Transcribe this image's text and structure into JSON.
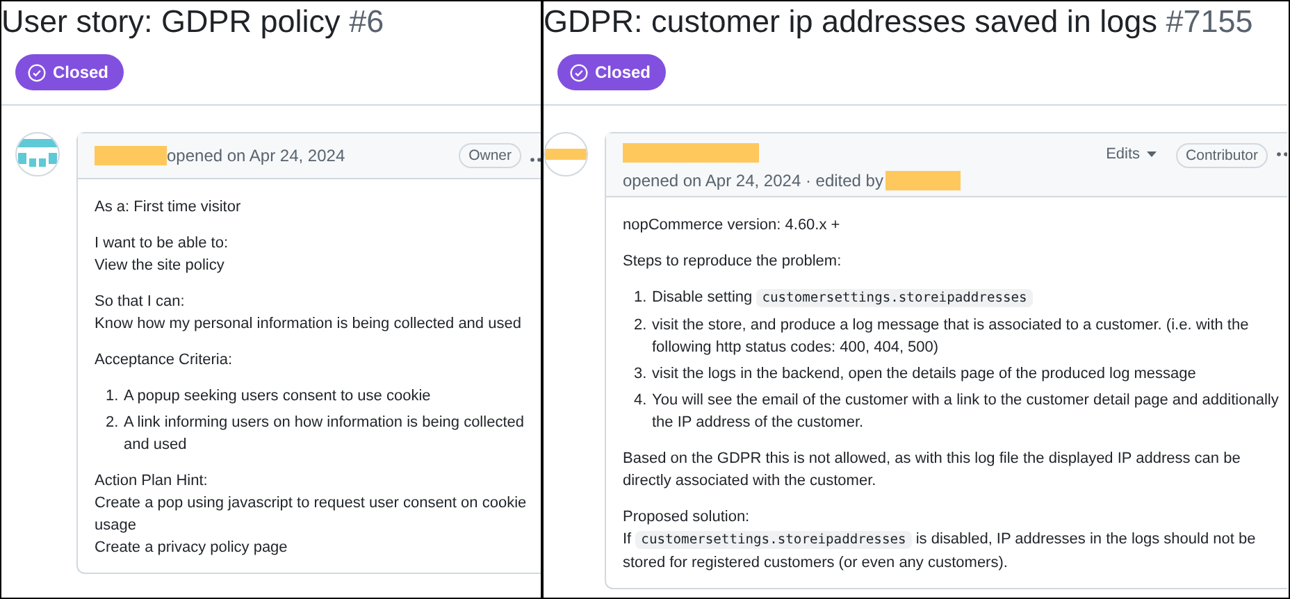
{
  "panels": [
    {
      "title": "User story: GDPR policy",
      "number": "#6",
      "status": {
        "kind": "closed",
        "label": "Closed"
      },
      "avatar": {
        "kind": "identicon"
      },
      "comment": {
        "author_hidden": true,
        "meta": "opened on Apr 24, 2024",
        "editor_hidden": false,
        "role": "Owner",
        "body": [
          {
            "kind": "paragraph",
            "lines": [
              [
                {
                  "kind": "text",
                  "text": "As a: First time visitor"
                }
              ]
            ]
          },
          {
            "kind": "paragraph",
            "lines": [
              [
                {
                  "kind": "text",
                  "text": "I want to be able to:"
                }
              ],
              [
                {
                  "kind": "text",
                  "text": "View the site policy"
                }
              ]
            ]
          },
          {
            "kind": "paragraph",
            "lines": [
              [
                {
                  "kind": "text",
                  "text": "So that I can:"
                }
              ],
              [
                {
                  "kind": "text",
                  "text": "Know how my personal information is being collected and used"
                }
              ]
            ]
          },
          {
            "kind": "paragraph",
            "lines": [
              [
                {
                  "kind": "text",
                  "text": "Acceptance Criteria:"
                }
              ]
            ]
          },
          {
            "kind": "ordered_list",
            "items": [
              {
                "marker": "1.",
                "segments": [
                  {
                    "kind": "text",
                    "text": "A popup seeking users consent to use cookie"
                  }
                ]
              },
              {
                "marker": "2.",
                "segments": [
                  {
                    "kind": "text",
                    "text": "A link informing users on how information is being collected and used"
                  }
                ]
              }
            ]
          },
          {
            "kind": "paragraph",
            "lines": [
              [
                {
                  "kind": "text",
                  "text": "Action Plan Hint:"
                }
              ],
              [
                {
                  "kind": "text",
                  "text": "Create a pop using javascript to request user consent on cookie usage"
                }
              ],
              [
                {
                  "kind": "text",
                  "text": "Create a privacy policy page"
                }
              ]
            ]
          }
        ]
      }
    },
    {
      "title": "GDPR: customer ip addresses saved in logs",
      "number": "#7155",
      "status": {
        "kind": "closed",
        "label": "Closed"
      },
      "avatar": {
        "kind": "hidden"
      },
      "comment": {
        "author_hidden": true,
        "meta": "opened on Apr 24, 2024 · edited by",
        "editor_hidden": true,
        "edits": "Edits",
        "role": "Contributor",
        "body": [
          {
            "kind": "paragraph",
            "lines": [
              [
                {
                  "kind": "text",
                  "text": "nopCommerce version: 4.60.x +"
                }
              ]
            ]
          },
          {
            "kind": "paragraph",
            "lines": [
              [
                {
                  "kind": "text",
                  "text": "Steps to reproduce the problem:"
                }
              ]
            ]
          },
          {
            "kind": "ordered_list",
            "items": [
              {
                "marker": "1.",
                "segments": [
                  {
                    "kind": "text",
                    "text": "Disable setting "
                  },
                  {
                    "kind": "code",
                    "text": "customersettings.storeipaddresses"
                  }
                ]
              },
              {
                "marker": "2.",
                "segments": [
                  {
                    "kind": "text",
                    "text": "visit the store, and produce a log message that is associated to a customer. (i.e. with the following http status codes: 400, 404, 500)"
                  }
                ]
              },
              {
                "marker": "3.",
                "segments": [
                  {
                    "kind": "text",
                    "text": "visit the logs in the backend, open the details page of the produced log message"
                  }
                ]
              },
              {
                "marker": "4.",
                "segments": [
                  {
                    "kind": "text",
                    "text": "You will see the email of the customer with a link to the customer detail page and additionally the IP address of the customer."
                  }
                ]
              }
            ]
          },
          {
            "kind": "paragraph",
            "lines": [
              [
                {
                  "kind": "text",
                  "text": "Based on the GDPR this is not allowed, as with this log file the displayed IP address can be directly associated with the customer."
                }
              ]
            ]
          },
          {
            "kind": "paragraph",
            "lines": [
              [
                {
                  "kind": "text",
                  "text": "Proposed solution:"
                }
              ],
              [
                {
                  "kind": "text",
                  "text": "If "
                },
                {
                  "kind": "code",
                  "text": "customersettings.storeipaddresses"
                },
                {
                  "kind": "text",
                  "text": " is disabled, IP addresses in the logs should not be stored for registered customers (or even any customers)."
                }
              ]
            ]
          }
        ]
      }
    }
  ]
}
